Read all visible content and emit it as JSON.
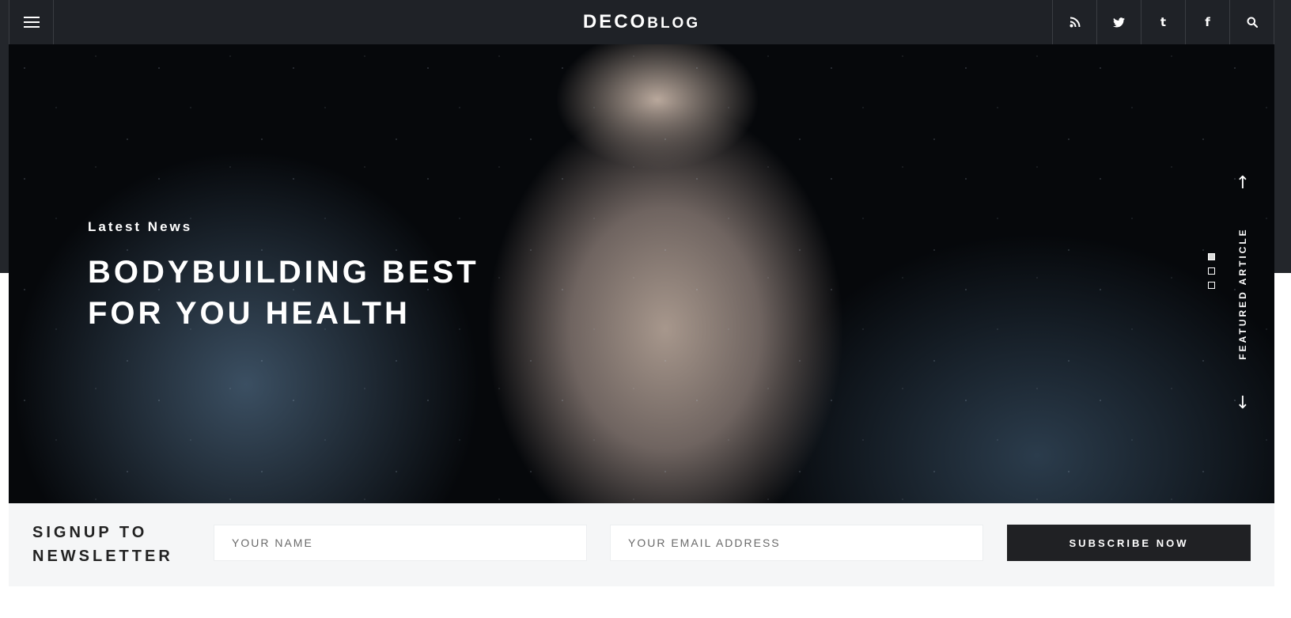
{
  "header": {
    "logo_primary": "DECO",
    "logo_secondary": "BLOG",
    "menu_icon": "hamburger-icon",
    "social": [
      "rss-icon",
      "twitter-icon",
      "tumblr-icon",
      "facebook-icon",
      "search-icon"
    ],
    "tumblr_glyph": "t",
    "facebook_glyph": "f"
  },
  "hero": {
    "kicker": "Latest News",
    "title": "BODYBUILDING BEST FOR YOU HEALTH",
    "featured_label": "FEATURED ARTICLE",
    "slides": 3,
    "active_slide": 1
  },
  "newsletter": {
    "title": "SIGNUP TO NEWSLETTER",
    "name_placeholder": "YOUR NAME",
    "email_placeholder": "YOUR EMAIL ADDRESS",
    "button_label": "SUBSCRIBE NOW"
  },
  "colors": {
    "header_bg": "#1f2227",
    "button_bg": "#202124",
    "newsletter_bg": "#f5f6f7"
  }
}
